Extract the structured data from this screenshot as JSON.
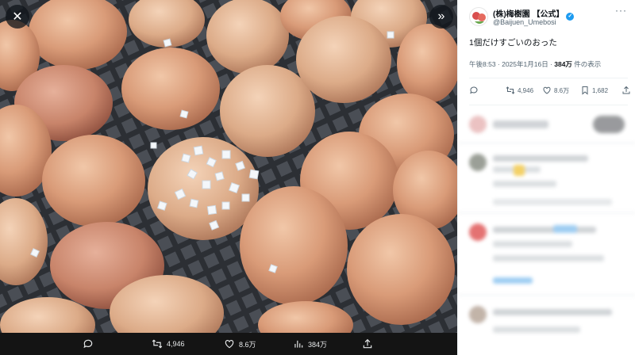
{
  "viewer": {
    "close_icon": "close-icon",
    "expand_icon": "double-chevron-right-icon"
  },
  "actions": {
    "retweets": "4,946",
    "likes": "8.6万",
    "views": "384万"
  },
  "post": {
    "author_name": "(株)梅樹園 【公式】",
    "author_handle": "@Baijuen_Umebosi",
    "text": "1個だけすごいのおった",
    "time": "午後8:53 · 2025年1月16日 · ",
    "views_count": "384万",
    "views_label": " 件の表示",
    "reply_count": "",
    "retweet_count": "4,946",
    "like_count": "8.6万",
    "bookmark_count": "1,682"
  },
  "colors": {
    "verified": "#1d9bf0",
    "text_primary": "#0f1419",
    "text_secondary": "#536471"
  }
}
